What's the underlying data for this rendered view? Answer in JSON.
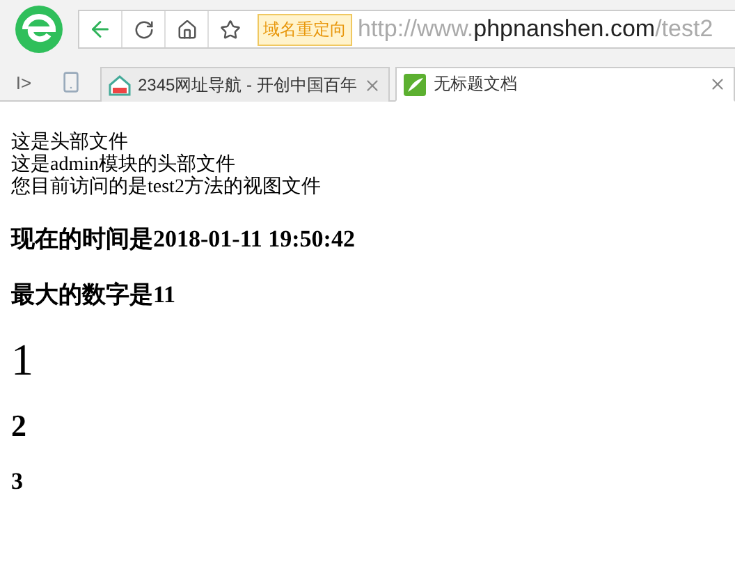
{
  "toolbar": {
    "badge": "域名重定向",
    "url": {
      "prefix": "http://www.",
      "domain": "phpnanshen.com",
      "path": "/test2"
    }
  },
  "sidebar_toggle": "I>",
  "tabs": [
    {
      "title": "2345网址导航 - 开创中国百年",
      "selected": false,
      "kind": "nav"
    },
    {
      "title": "无标题文档",
      "selected": true,
      "kind": "doc"
    }
  ],
  "page": {
    "lines": [
      "这是头部文件",
      "这是admin模块的头部文件",
      "您目前访问的是test2方法的视图文件"
    ],
    "headings": [
      {
        "text": "现在的时间是2018-01-11 19:50:42",
        "kind": "h3"
      },
      {
        "text": "最大的数字是11",
        "kind": "h3"
      },
      {
        "text": "1",
        "kind": "h1"
      },
      {
        "text": "2",
        "kind": "h2"
      },
      {
        "text": "3",
        "kind": "h3"
      }
    ]
  }
}
